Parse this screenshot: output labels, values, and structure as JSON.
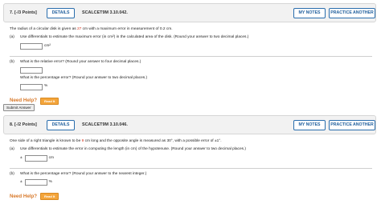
{
  "questions": [
    {
      "number": "7.",
      "points": "[-/3 Points]",
      "details_label": "DETAILS",
      "id": "SCALCET9M 3.10.042.",
      "my_notes_label": "MY NOTES",
      "practice_label": "PRACTICE ANOTHER",
      "statement_pre": "The radius of a circular disk is given as ",
      "statement_hl": "27",
      "statement_post": " cm with a maximum error in measurement of 0.2 cm.",
      "parts": [
        {
          "label": "(a)",
          "text": "Use differentials to estimate the maximum error (in cm²) in the calculated area of the disk. (Round your answer to two decimal places.)",
          "unit": "cm²"
        },
        {
          "label": "(b)",
          "text": "What is the relative error? (Round your answer to four decimal places.)",
          "unit": ""
        },
        {
          "label": "",
          "text": "What is the percentage error? (Round your answer to two decimal places.)",
          "unit": "%"
        }
      ],
      "need_help": "Need Help?",
      "read_it": "Read It"
    },
    {
      "number": "8.",
      "points": "[-/2 Points]",
      "details_label": "DETAILS",
      "id": "SCALCET9M 3.10.046.",
      "my_notes_label": "MY NOTES",
      "practice_label": "PRACTICE ANOTHER",
      "statement_pre": "One side of a right triangle is known to be ",
      "statement_hl": "9",
      "statement_post": " cm long and the opposite angle is measured as 30°, with a possible error of ±1°.",
      "parts": [
        {
          "label": "(a)",
          "text": "Use differentials to estimate the error in computing the length (in cm) of the hypotenuse. (Round your answer to two decimal places.)",
          "prefix": "±",
          "unit": "cm"
        },
        {
          "label": "(b)",
          "text": "What is the percentage error? (Round your answer to the nearest integer.)",
          "prefix": "±",
          "unit": "%"
        }
      ],
      "need_help": "Need Help?",
      "read_it": "Read It"
    }
  ],
  "submit_label": "Submit Answer"
}
